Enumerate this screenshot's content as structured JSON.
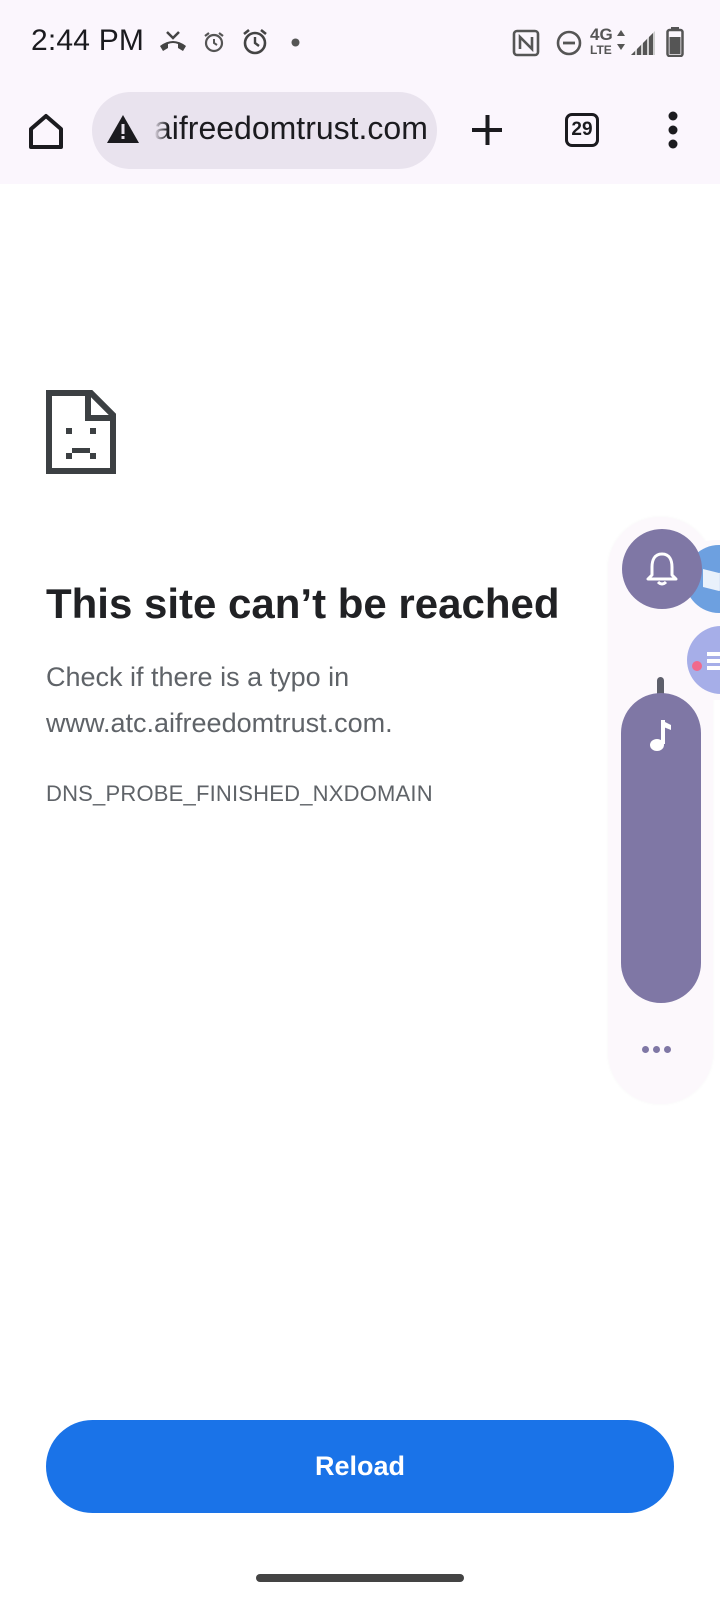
{
  "status_bar": {
    "time": "2:44 PM",
    "network_label": "4G",
    "network_sublabel": "LTE",
    "icons": [
      "missed-call-icon",
      "alarm-small-icon",
      "alarm-icon",
      "notification-dot-icon",
      "nfc-icon",
      "do-not-disturb-icon",
      "network-4g-lte-icon",
      "signal-icon",
      "battery-icon"
    ]
  },
  "toolbar": {
    "url": "aifreedomtrust.com",
    "tab_count": "29",
    "icons": [
      "home-icon",
      "warning-icon",
      "new-tab-icon",
      "tab-switcher-icon",
      "more-vert-icon"
    ]
  },
  "error_page": {
    "title": "This site can’t be reached",
    "description_line1": "Check if there is a typo in",
    "description_line2": "www.atc.aifreedomtrust.com.",
    "error_code": "DNS_PROBE_FINISHED_NXDOMAIN",
    "reload_label": "Reload"
  },
  "volume_panel": {
    "accent_color": "#7f77a5",
    "icons": [
      "bell-icon",
      "music-note-icon",
      "more-horiz-icon"
    ]
  },
  "colors": {
    "primary": "#1a73e8",
    "chrome_background": "#fbf6fd",
    "omnibox_background": "#e9e3ee",
    "title_text": "#202124",
    "secondary_text": "#5f6368"
  }
}
